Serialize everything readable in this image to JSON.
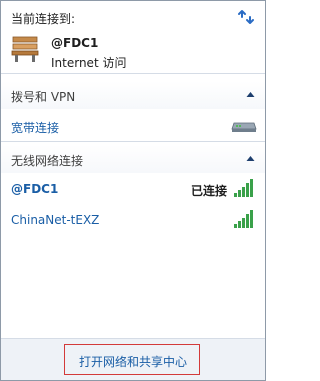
{
  "header": {
    "title": "当前连接到:",
    "connection": {
      "name": "@FDC1",
      "status": "Internet 访问"
    }
  },
  "sections": {
    "dialup": {
      "title": "拨号和 VPN",
      "items": [
        {
          "label": "宽带连接"
        }
      ]
    },
    "wireless": {
      "title": "无线网络连接",
      "items": [
        {
          "label": "@FDC1",
          "status": "已连接",
          "signal_bars": 5
        },
        {
          "label": "ChinaNet-tEXZ",
          "status": "",
          "signal_bars": 5
        }
      ]
    }
  },
  "footer": {
    "link": "打开网络和共享中心"
  },
  "colors": {
    "link": "#1a5ea6",
    "signal": "#3aa14a",
    "highlight_box": "#d33a3a"
  },
  "icons": {
    "refresh": "refresh-arrows-icon",
    "bench": "network-bench-icon",
    "modem": "modem-icon",
    "collapse": "chevron-up-icon",
    "signal": "wifi-signal-icon"
  }
}
